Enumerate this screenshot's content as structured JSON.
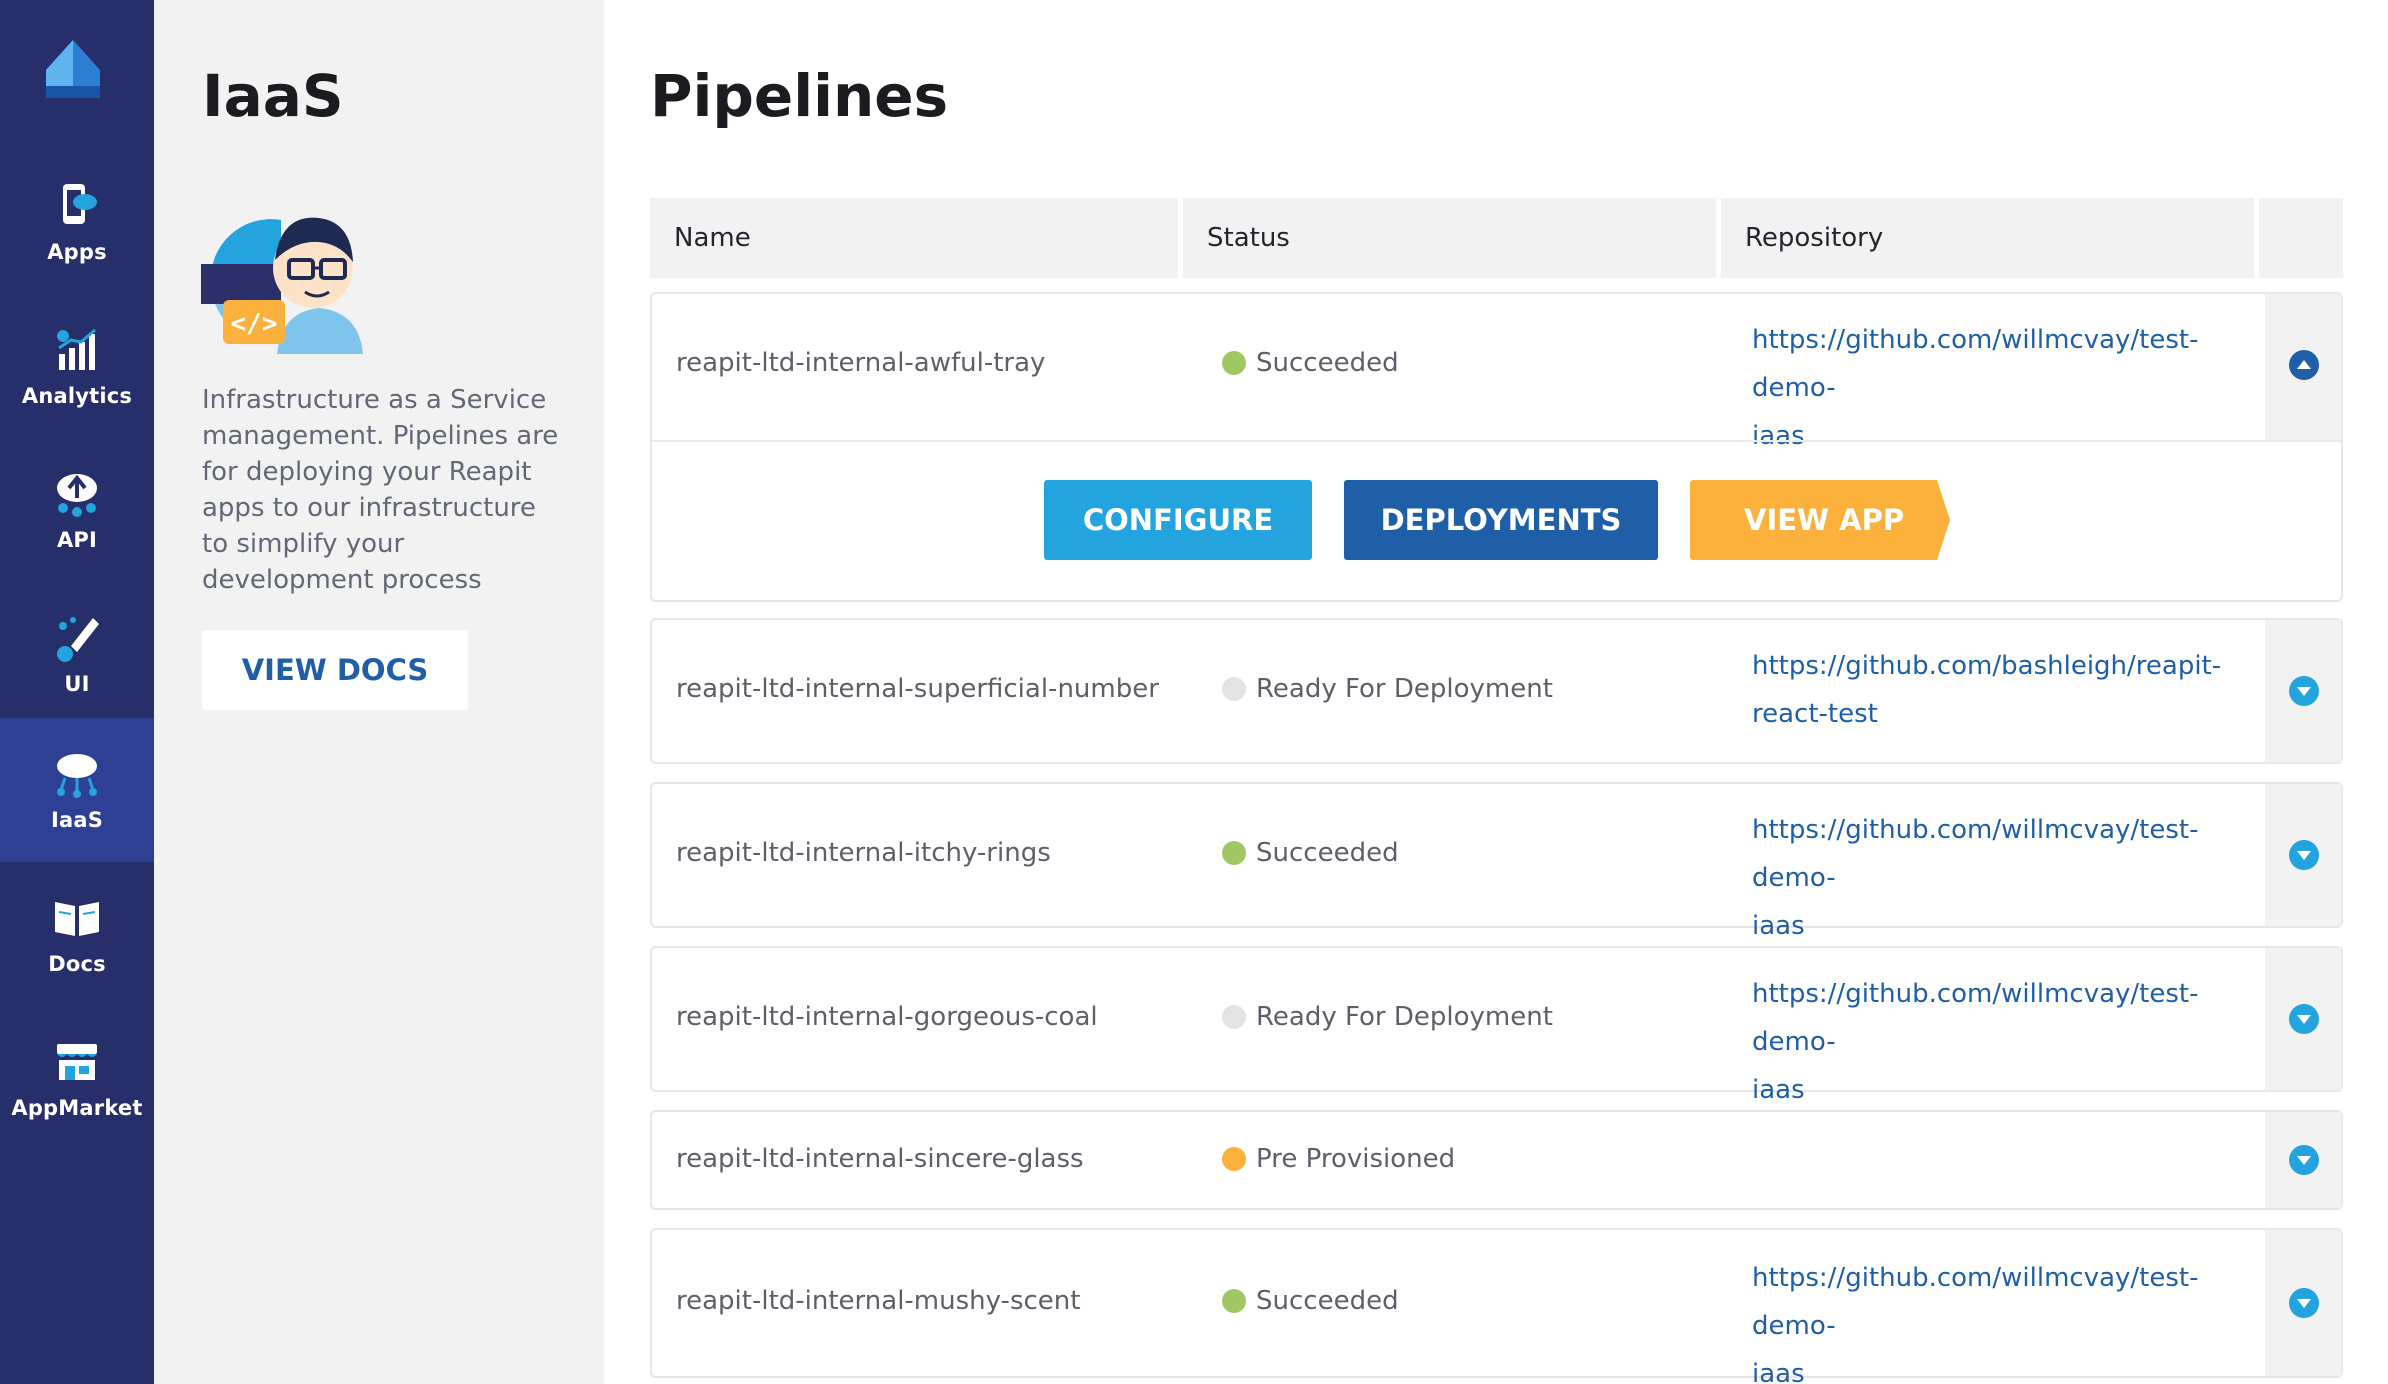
{
  "nav": {
    "items": [
      {
        "label": "Apps",
        "icon": "apps-icon"
      },
      {
        "label": "Analytics",
        "icon": "analytics-icon"
      },
      {
        "label": "API",
        "icon": "api-icon"
      },
      {
        "label": "UI",
        "icon": "ui-icon"
      },
      {
        "label": "IaaS",
        "icon": "iaas-icon",
        "active": true
      },
      {
        "label": "Docs",
        "icon": "docs-icon"
      },
      {
        "label": "AppMarket",
        "icon": "appmarket-icon"
      }
    ]
  },
  "panel": {
    "title": "IaaS",
    "description": "Infrastructure as a Service management. Pipelines are for deploying your Reapit apps to our infrastructure to simplify your development process",
    "view_docs_label": "VIEW DOCS"
  },
  "main": {
    "title": "Pipelines",
    "columns": [
      "Name",
      "Status",
      "Repository"
    ],
    "rows": [
      {
        "name": "reapit-ltd-internal-awful-tray",
        "status": "Succeeded",
        "status_color": "#a0c862",
        "repo_line1": "https://github.com/willmcvay/test-demo-",
        "repo_line2": "iaas",
        "expanded": true
      },
      {
        "name": "reapit-ltd-internal-superficial-number",
        "status": "Ready For Deployment",
        "status_color": "#e3e3e3",
        "repo_line1": "https://github.com/bashleigh/reapit-",
        "repo_line2": "react-test"
      },
      {
        "name": "reapit-ltd-internal-itchy-rings",
        "status": "Succeeded",
        "status_color": "#a0c862",
        "repo_line1": "https://github.com/willmcvay/test-demo-",
        "repo_line2": "iaas"
      },
      {
        "name": "reapit-ltd-internal-gorgeous-coal",
        "status": "Ready For Deployment",
        "status_color": "#e3e3e3",
        "repo_line1": "https://github.com/willmcvay/test-demo-",
        "repo_line2": "iaas"
      },
      {
        "name": "reapit-ltd-internal-sincere-glass",
        "status": "Pre Provisioned",
        "status_color": "#fbb13c",
        "repo_line1": "",
        "repo_line2": ""
      },
      {
        "name": "reapit-ltd-internal-mushy-scent",
        "status": "Succeeded",
        "status_color": "#a0c862",
        "repo_line1": "https://github.com/willmcvay/test-demo-",
        "repo_line2": "iaas"
      }
    ],
    "actions": {
      "configure_label": "CONFIGURE",
      "deployments_label": "DEPLOYMENTS",
      "view_app_label": "VIEW APP"
    }
  },
  "colors": {
    "nav_bg": "#262f69",
    "nav_active": "#2d4093",
    "accent_blue": "#23a4de",
    "dark_blue": "#1f5fa8",
    "yellow": "#fbb13c",
    "success_green": "#a0c862"
  }
}
